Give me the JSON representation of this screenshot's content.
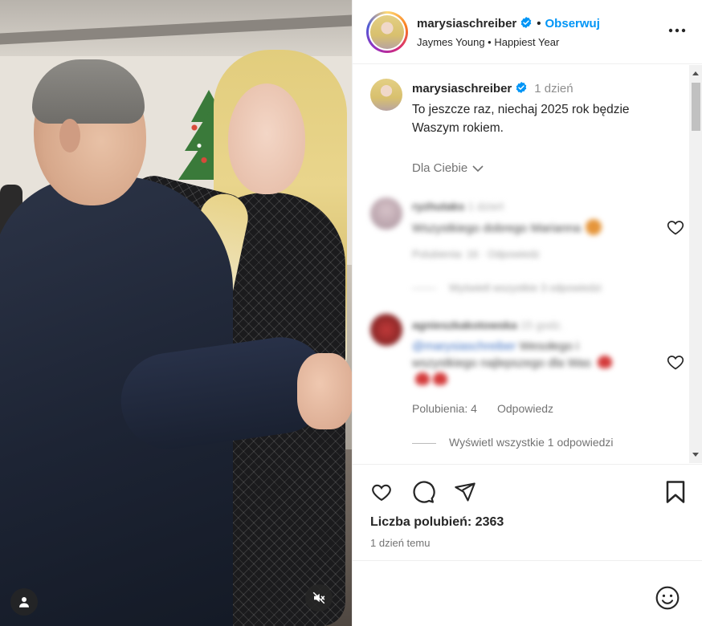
{
  "post": {
    "username": "marysiaschreiber",
    "follow_label": "Obserwuj",
    "separator": "•",
    "audio": "Jaymes Young • Happiest Year"
  },
  "caption": {
    "username": "marysiaschreiber",
    "time": "1 dzień",
    "text": "To jeszcze raz, niechaj 2025 rok będzie Waszym rokiem.",
    "for_you_label": "Dla Ciebie"
  },
  "comments": [
    {
      "username": "ryzhutaks",
      "time": "1 dzień",
      "text": "Wszystkiego dobrego Marianna",
      "meta": "Polubienia: 16 · Odpowiedz",
      "view_replies": "Wyświetl wszystkie 3 odpowiedzi"
    },
    {
      "username": "agnieszkakotowska",
      "time": "15 godz.",
      "mention": "@marysiaschreiber",
      "text_rest": "Wesołego i wszystkiego najlepszego dla Was",
      "likes_label": "Polubienia: 4",
      "reply_label": "Odpowiedz",
      "view_replies": "Wyświetl wszystkie 1 odpowiedzi"
    }
  ],
  "actions": {
    "likes": "Liczba polubień: 2363",
    "posted": "1 dzień temu"
  },
  "icons": {
    "verified": "verified-badge-icon",
    "more": "more-options-icon",
    "like": "heart-icon",
    "comment": "comment-icon",
    "share": "share-icon",
    "save": "bookmark-icon",
    "emoji": "emoji-icon",
    "tag": "user-tag-icon",
    "mute": "muted-speaker-icon"
  },
  "colors": {
    "accent": "#0095f6",
    "text": "#262626",
    "muted": "#737373",
    "verified": "#0095f6"
  }
}
